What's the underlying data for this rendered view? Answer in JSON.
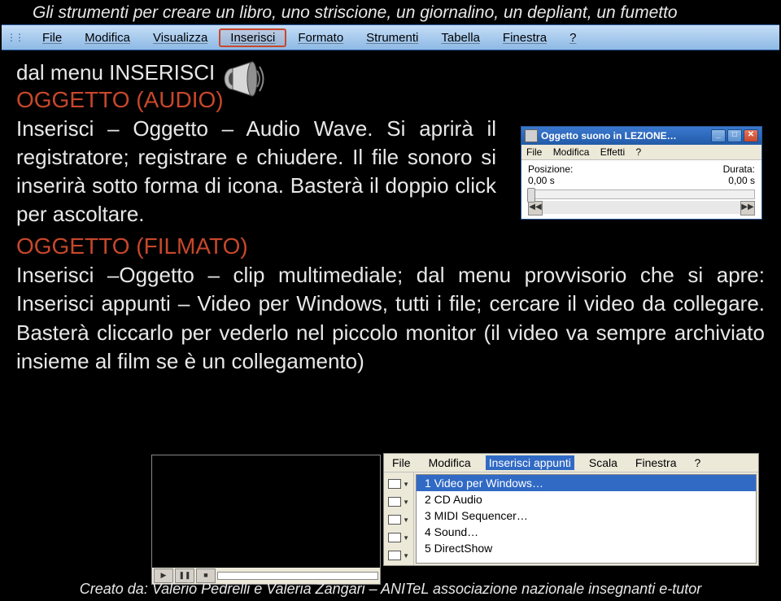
{
  "header": {
    "title": "Gli strumenti per creare un libro, uno striscione, un giornalino, un depliant, un fumetto"
  },
  "menubar": {
    "items": [
      "File",
      "Modifica",
      "Visualizza",
      "Inserisci",
      "Formato",
      "Strumenti",
      "Tabella",
      "Finestra",
      "?"
    ],
    "highlighted_index": 3
  },
  "content": {
    "line1": "dal menu INSERISCI",
    "heading_audio": "OGGETTO (AUDIO)",
    "para_audio": "Inserisci – Oggetto – Audio Wave. Si aprirà il registratore; registrare e chiudere. Il file sonoro si inserirà sotto forma di icona. Basterà il doppio click per ascoltare.",
    "heading_filmato": "OGGETTO (FILMATO)",
    "para_filmato": "Inserisci –Oggetto – clip multimediale; dal menu provvisorio che si apre: Inserisci appunti – Video per Windows, tutti i file; cercare il video da collegare. Basterà cliccarlo per vederlo nel piccolo monitor (il video va sempre archiviato insieme al film se è un collegamento)"
  },
  "audio_window": {
    "title": "Oggetto suono in LEZIONE…",
    "menu": [
      "File",
      "Modifica",
      "Effetti",
      "?"
    ],
    "labels": {
      "position": "Posizione:",
      "duration": "Durata:"
    },
    "values": {
      "position": "0,00 s",
      "duration": "0,00 s"
    }
  },
  "video_controls": {
    "play": "▶",
    "pause": "❚❚",
    "stop": "■"
  },
  "insert_menu": {
    "menubar": [
      "File",
      "Modifica",
      "Inserisci appunti",
      "Scala",
      "Finestra",
      "?"
    ],
    "selected_menubar_index": 2,
    "items": [
      "1 Video per Windows…",
      "2 CD Audio",
      "3 MIDI Sequencer…",
      "4 Sound…",
      "5 DirectShow"
    ],
    "selected_item_index": 0
  },
  "footer": {
    "text": "Creato da: Valerio Pedrelli e Valeria Zangari – ANITeL associazione nazionale insegnanti e-tutor"
  }
}
